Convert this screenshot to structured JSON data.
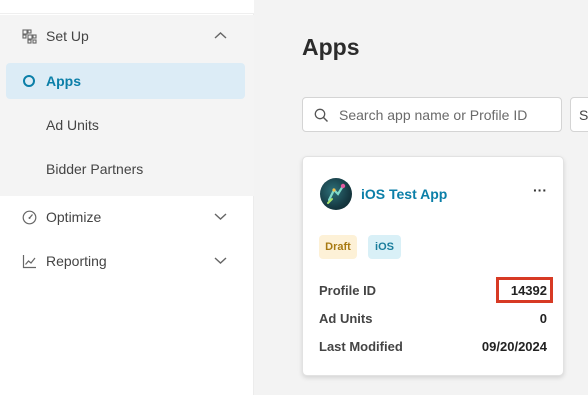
{
  "sidebar": {
    "items": [
      {
        "label": "Set Up",
        "icon": "grid-icon",
        "expanded": true
      },
      {
        "label": "Apps",
        "icon": "circle-icon",
        "active": true
      },
      {
        "label": "Ad Units"
      },
      {
        "label": "Bidder Partners"
      },
      {
        "label": "Optimize",
        "icon": "gauge-icon",
        "expanded": false
      },
      {
        "label": "Reporting",
        "icon": "chart-line-icon",
        "expanded": false
      }
    ]
  },
  "main": {
    "title": "Apps",
    "search": {
      "placeholder": "Search app name or Profile ID",
      "value": ""
    },
    "second_select_label": "S"
  },
  "card": {
    "app_name": "iOS Test App",
    "more_label": "···",
    "badges": [
      {
        "label": "Draft"
      },
      {
        "label": "iOS"
      }
    ],
    "rows": [
      {
        "label": "Profile ID",
        "value": "14392"
      },
      {
        "label": "Ad Units",
        "value": "0"
      },
      {
        "label": "Last Modified",
        "value": "09/20/2024"
      }
    ]
  },
  "colors": {
    "accent": "#0b7fa8",
    "active_bg": "#dcecf6",
    "draft_bg": "#fdf1d7",
    "ios_bg": "#d9f0f7",
    "highlight": "#d73a24"
  }
}
